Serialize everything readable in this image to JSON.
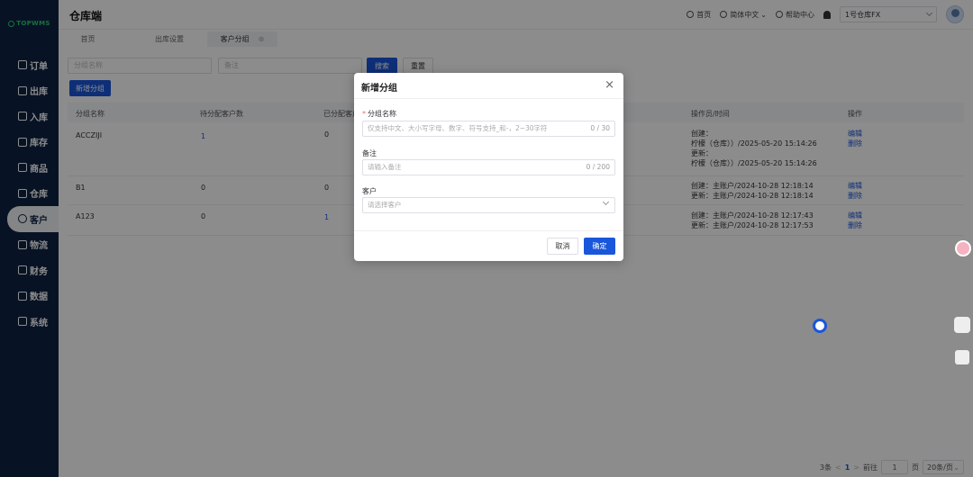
{
  "sidebar": {
    "logo": "TOPWMS",
    "items": [
      {
        "label": "订单"
      },
      {
        "label": "出库"
      },
      {
        "label": "入库"
      },
      {
        "label": "库存"
      },
      {
        "label": "商品"
      },
      {
        "label": "仓库"
      },
      {
        "label": "客户"
      },
      {
        "label": "物流"
      },
      {
        "label": "财务"
      },
      {
        "label": "数据"
      },
      {
        "label": "系统"
      }
    ]
  },
  "header": {
    "title": "仓库端",
    "home": "首页",
    "language": "简体中文",
    "help": "帮助中心",
    "warehouse": "1号仓库FX"
  },
  "tabs": [
    {
      "label": "首页"
    },
    {
      "label": "出库设置"
    },
    {
      "label": "客户分组",
      "close": "⊗"
    }
  ],
  "filters": {
    "group_name_placeholder": "分组名称",
    "remark_placeholder": "备注",
    "search_label": "搜索",
    "reset_label": "重置",
    "add_label": "新增分组"
  },
  "table": {
    "headers": [
      "分组名称",
      "待分配客户数",
      "已分配客户",
      "操作员/时间",
      "操作"
    ],
    "rows": [
      {
        "name": "ACCZIJI",
        "pending": "1",
        "assigned": "0",
        "op_lines": [
          "创建：",
          "柠檬（仓库））/2025-05-20 15:14:26",
          "更新：",
          "柠檬（仓库））/2025-05-20 15:14:26"
        ],
        "edit": "编辑",
        "delete": "删除"
      },
      {
        "name": "B1",
        "pending": "0",
        "assigned": "0",
        "op_lines": [
          "创建：主账户/2024-10-28 12:18:14",
          "更新：主账户/2024-10-28 12:18:14"
        ],
        "edit": "编辑",
        "delete": "删除"
      },
      {
        "name": "A123",
        "pending": "0",
        "assigned": "1",
        "op_lines": [
          "创建：主账户/2024-10-28 12:17:43",
          "更新：主账户/2024-10-28 12:17:53"
        ],
        "edit": "编辑",
        "delete": "删除"
      }
    ]
  },
  "modal": {
    "title": "新增分组",
    "close": "×",
    "name_label": "分组名称",
    "name_placeholder": "仅支持中文、大小写字母、数字、符号支持_和-，2~30字符",
    "name_counter": "0 / 30",
    "remark_label": "备注",
    "remark_placeholder": "请输入备注",
    "remark_counter": "0 / 200",
    "customer_label": "客户",
    "customer_placeholder": "请选择客户",
    "cancel_label": "取消",
    "confirm_label": "确定"
  },
  "pagination": {
    "total": "3条",
    "prev": "<",
    "current": "1",
    "next": ">",
    "goto": "前往",
    "page_input": "1",
    "page_unit": "页",
    "page_size": "20条/页"
  },
  "colors": {
    "sidebar": "#0d2344",
    "primary": "#1a56db"
  }
}
